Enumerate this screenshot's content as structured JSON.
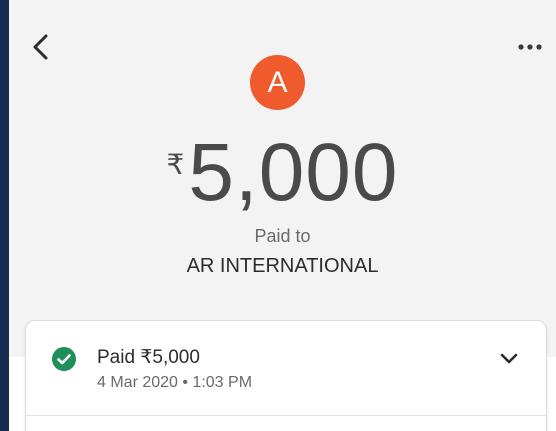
{
  "header": {
    "back_icon": "chevron-left-icon",
    "more_icon": "more-horizontal-icon"
  },
  "recipient": {
    "avatar_letter": "A",
    "avatar_color": "#ef5b2c",
    "paid_to_label": "Paid to",
    "name": "AR INTERNATIONAL"
  },
  "payment": {
    "currency_symbol": "₹",
    "amount": "5,000"
  },
  "status_card": {
    "status_icon": "check-circle-icon",
    "status_color": "#1e8e5a",
    "title": "Paid ₹5,000",
    "timestamp": "4 Mar 2020 • 1:03 PM",
    "expand_icon": "chevron-down-icon"
  }
}
